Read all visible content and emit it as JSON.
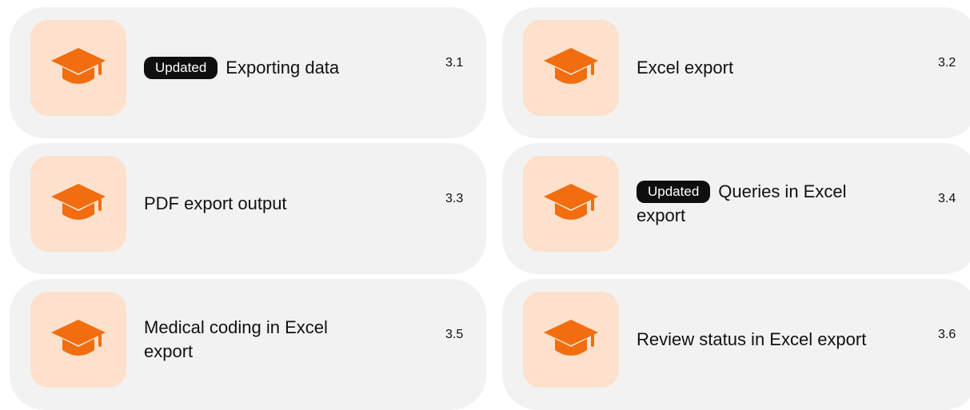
{
  "colors": {
    "card_bg": "#f2f2f2",
    "icon_tile_bg": "#fde1cc",
    "icon_color": "#f26d0f",
    "badge_bg": "#0f0f0f"
  },
  "cards": [
    {
      "badge": "Updated",
      "title": "Exporting data",
      "number": "3.1",
      "icon": "graduation-cap-icon"
    },
    {
      "badge": "",
      "title": "Excel export",
      "number": "3.2",
      "icon": "graduation-cap-icon"
    },
    {
      "badge": "",
      "title": "PDF export output",
      "number": "3.3",
      "icon": "graduation-cap-icon"
    },
    {
      "badge": "Updated",
      "title": "Queries in Excel export",
      "number": "3.4",
      "icon": "graduation-cap-icon"
    },
    {
      "badge": "",
      "title": "Medical coding in Excel export",
      "number": "3.5",
      "icon": "graduation-cap-icon"
    },
    {
      "badge": "",
      "title": "Review status in Excel export",
      "number": "3.6",
      "icon": "graduation-cap-icon"
    }
  ]
}
